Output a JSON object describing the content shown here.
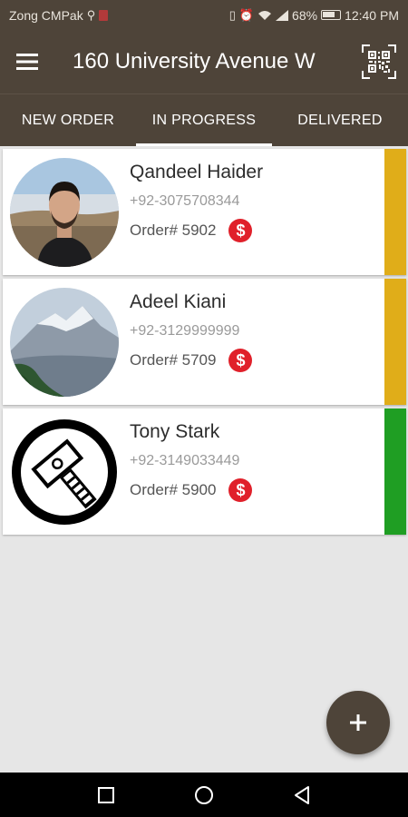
{
  "status_bar": {
    "carrier": "Zong CMPak",
    "battery": "68%",
    "time": "12:40 PM"
  },
  "app_bar": {
    "title": "160 University Avenue W",
    "menu_icon": "hamburger-menu-icon",
    "qr_icon": "qr-code-icon"
  },
  "tabs": [
    {
      "label": "NEW ORDER",
      "active": false
    },
    {
      "label": "IN PROGRESS",
      "active": true
    },
    {
      "label": "DELIVERED",
      "active": false
    }
  ],
  "orders": [
    {
      "name": "Qandeel Haider",
      "phone": "+92-3075708344",
      "order": "Order# 5902",
      "payment_icon": "dollar-icon",
      "status_color": "#e0ad19"
    },
    {
      "name": "Adeel Kiani",
      "phone": "+92-3129999999",
      "order": "Order# 5709",
      "payment_icon": "dollar-icon",
      "status_color": "#e0ad19"
    },
    {
      "name": "Tony Stark",
      "phone": "+92-3149033449",
      "order": "Order# 5900",
      "payment_icon": "dollar-icon",
      "status_color": "#1f9e23"
    }
  ],
  "fab": {
    "icon": "plus-icon"
  },
  "nav_bar": {
    "icons": [
      "recent-apps-icon",
      "home-icon",
      "back-icon"
    ]
  },
  "colors": {
    "primary": "#4e4439",
    "in_progress": "#e0ad19",
    "ready": "#1f9e23",
    "payment": "#e0202a"
  }
}
